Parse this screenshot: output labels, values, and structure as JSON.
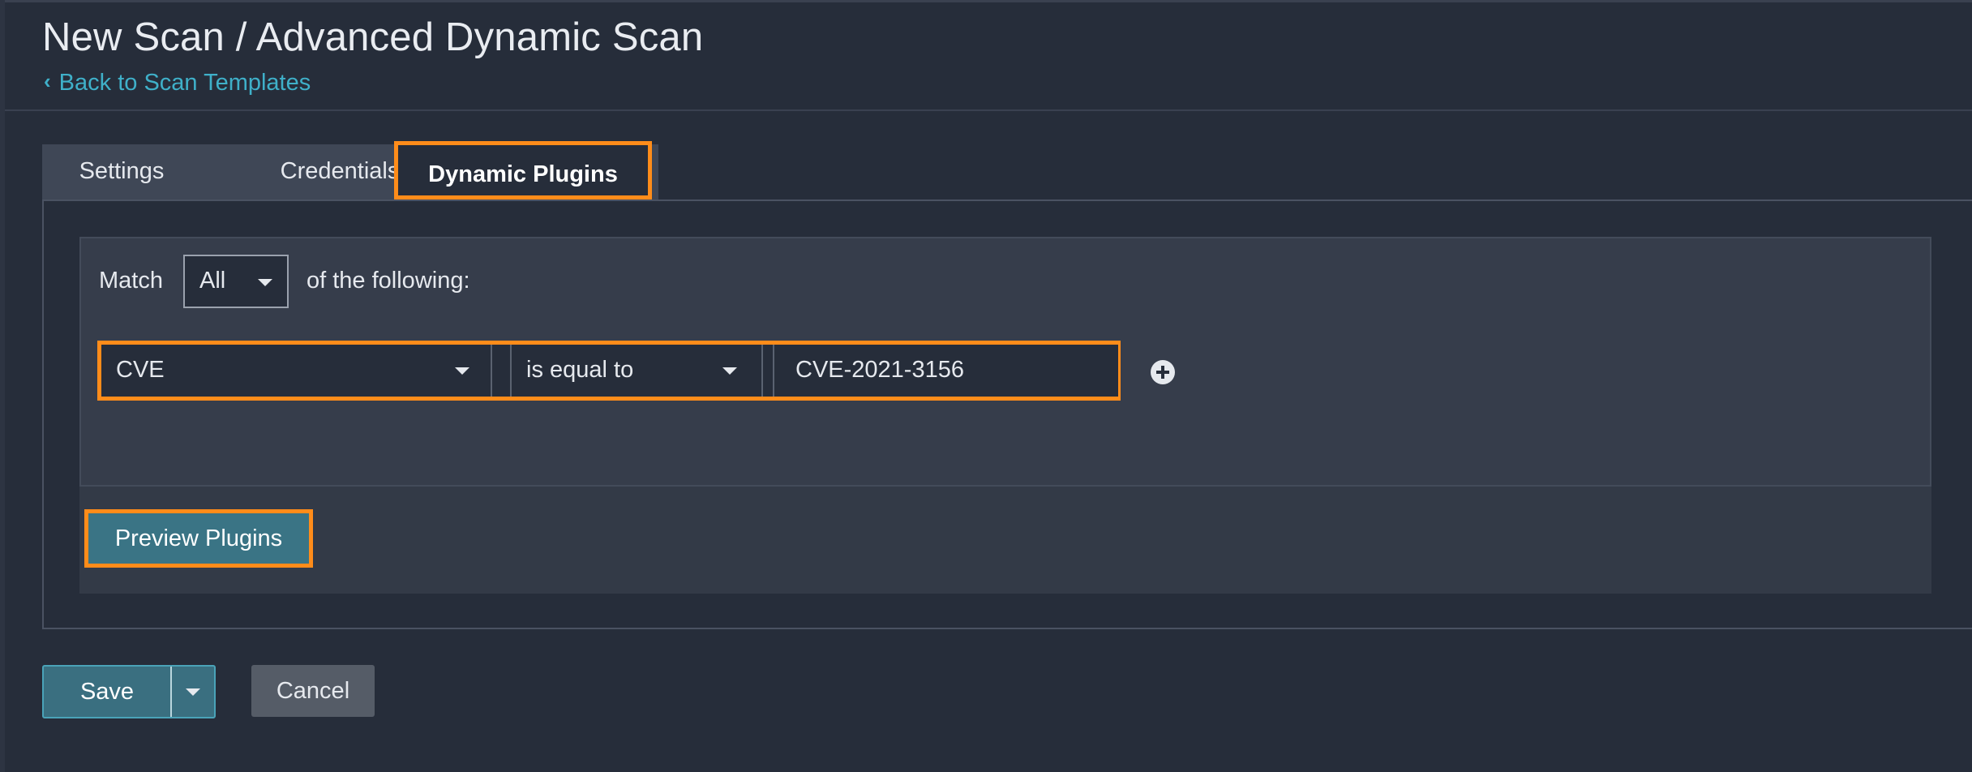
{
  "header": {
    "title": "New Scan / Advanced Dynamic Scan",
    "back_link": "Back to Scan Templates"
  },
  "tabs": [
    {
      "label": "Settings",
      "active": false
    },
    {
      "label": "Credentials",
      "active": false
    },
    {
      "label": "Dynamic Plugins",
      "active": true
    }
  ],
  "match": {
    "label": "Match",
    "selected": "All",
    "suffix": "of the following:"
  },
  "filter": {
    "field": "CVE",
    "operator": "is equal to",
    "value": "CVE-2021-3156"
  },
  "icons": {
    "back": "chevron-left-icon",
    "dropdown": "caret-down-icon",
    "add": "plus-circle-icon"
  },
  "buttons": {
    "preview": "Preview Plugins",
    "save": "Save",
    "cancel": "Cancel"
  },
  "colors": {
    "highlight": "#ff8c1a",
    "link": "#3fb0c9",
    "primary_button": "#3a7485",
    "background": "#262d3a"
  }
}
